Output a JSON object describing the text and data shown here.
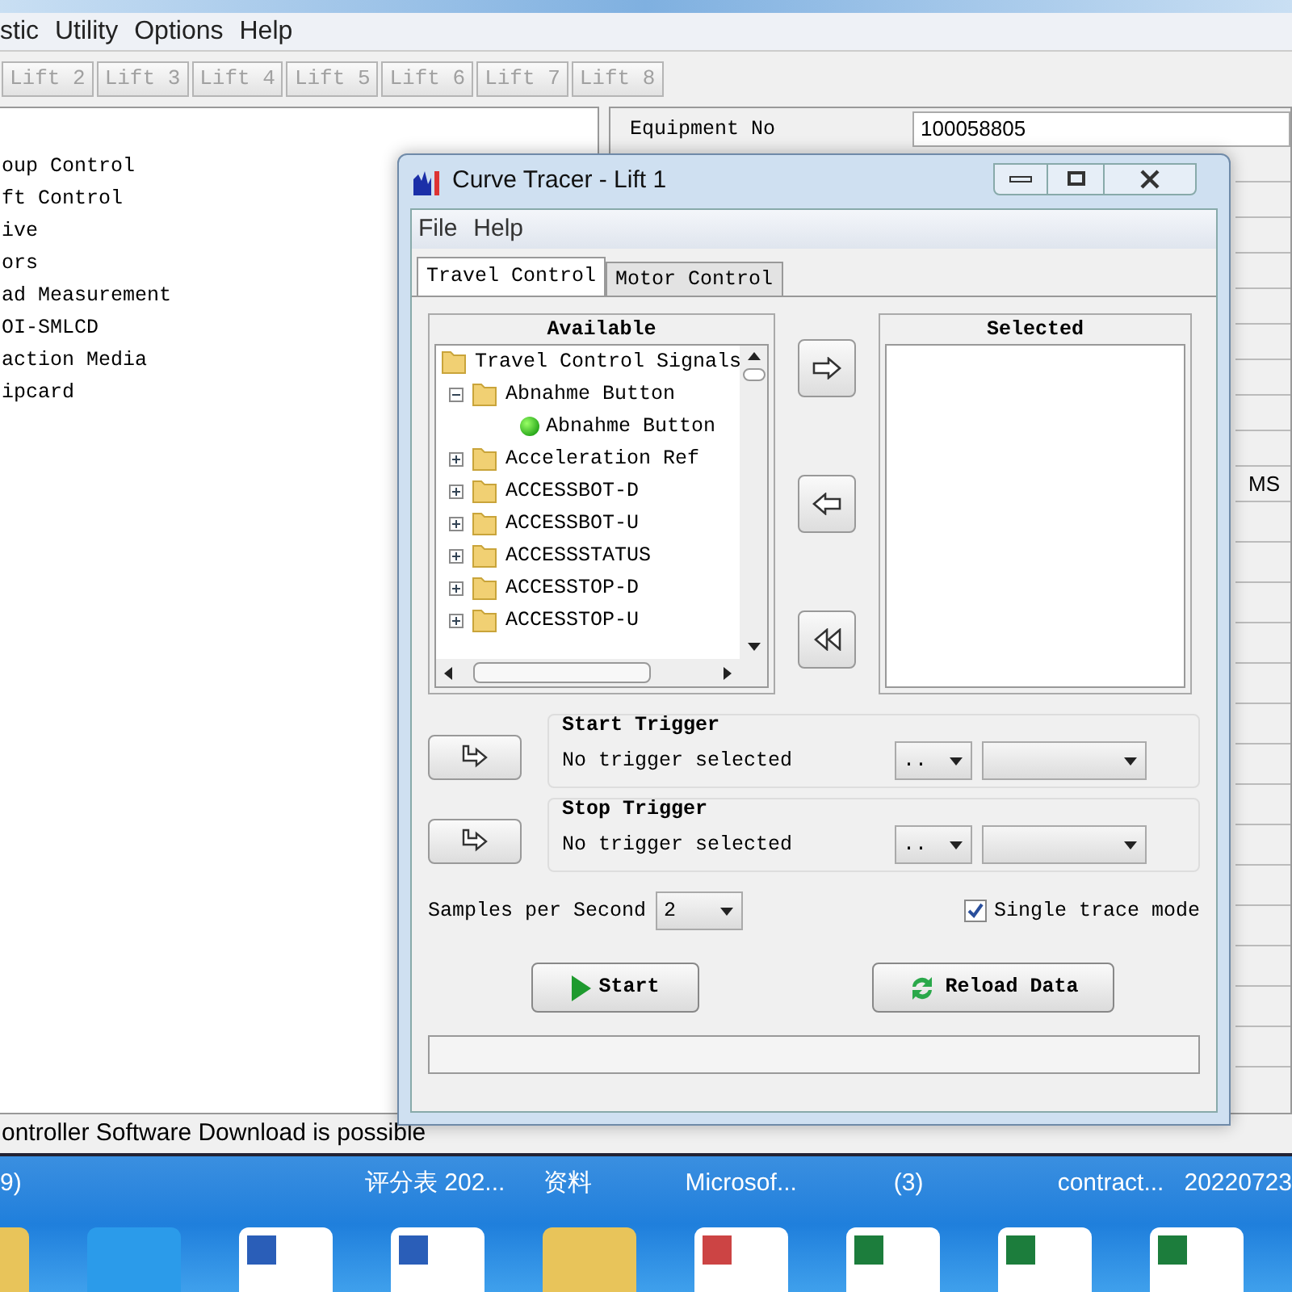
{
  "app": {
    "menu": [
      "stic",
      "Utility",
      "Options",
      "Help"
    ],
    "lift_tabs": [
      {
        "label": "Lift 2",
        "disabled": true
      },
      {
        "label": "Lift 3",
        "disabled": true
      },
      {
        "label": "Lift 4",
        "disabled": true
      },
      {
        "label": "Lift 5",
        "disabled": true
      },
      {
        "label": "Lift 6",
        "disabled": true
      },
      {
        "label": "Lift 7",
        "disabled": true
      },
      {
        "label": "Lift 8",
        "disabled": true
      }
    ],
    "tree_items": [
      "oup Control",
      "ft Control",
      "ive",
      "ors",
      "ad Measurement",
      "OI-SMLCD",
      "action Media",
      "ipcard"
    ],
    "equipment_label": "Equipment No",
    "equipment_value": "100058805",
    "side_value": "MS",
    "status": "ontroller Software Download is possible"
  },
  "dialog": {
    "title": "Curve Tracer - Lift 1",
    "menu": [
      "File",
      "Help"
    ],
    "tabs": [
      {
        "label": "Travel Control",
        "selected": true
      },
      {
        "label": "Motor Control",
        "selected": false
      }
    ],
    "available": {
      "header": "Available",
      "items": [
        {
          "label": "Travel Control Signals",
          "kind": "folder",
          "children": [
            {
              "label": "Abnahme Button",
              "kind": "folder",
              "expanded": true,
              "children": [
                {
                  "label": "Abnahme Button",
                  "kind": "signal"
                }
              ]
            },
            {
              "label": "Acceleration Ref",
              "kind": "folder",
              "expanded": false
            },
            {
              "label": "ACCESSBOT-D",
              "kind": "folder",
              "expanded": false
            },
            {
              "label": "ACCESSBOT-U",
              "kind": "folder",
              "expanded": false
            },
            {
              "label": "ACCESSSTATUS",
              "kind": "folder",
              "expanded": false
            },
            {
              "label": "ACCESSTOP-D",
              "kind": "folder",
              "expanded": false
            },
            {
              "label": "ACCESSTOP-U",
              "kind": "folder",
              "expanded": false
            }
          ]
        }
      ]
    },
    "selected": {
      "header": "Selected"
    },
    "triggers": [
      {
        "title": "Start Trigger",
        "text": "No trigger selected",
        "operator": ".."
      },
      {
        "title": "Stop Trigger",
        "text": "No trigger selected",
        "operator": ".."
      }
    ],
    "samples": {
      "label": "Samples per Second",
      "value": "2"
    },
    "single_trace": {
      "label": "Single trace mode",
      "checked": true
    },
    "buttons": [
      {
        "label": "Start",
        "kind": "start"
      },
      {
        "label": "Reload Data",
        "kind": "reload"
      }
    ]
  },
  "taskbar": {
    "labels": [
      "9)",
      "评分表 202...",
      "资料",
      "Microsof...",
      "(3)",
      "contract...",
      "20220723"
    ],
    "desktop_icons": [
      {
        "kind": "folder"
      },
      {
        "kind": "app"
      },
      {
        "kind": "word"
      },
      {
        "kind": "word"
      },
      {
        "kind": "folder"
      },
      {
        "kind": "ppt"
      },
      {
        "kind": "excel"
      },
      {
        "kind": "excel"
      },
      {
        "kind": "excel"
      }
    ]
  }
}
